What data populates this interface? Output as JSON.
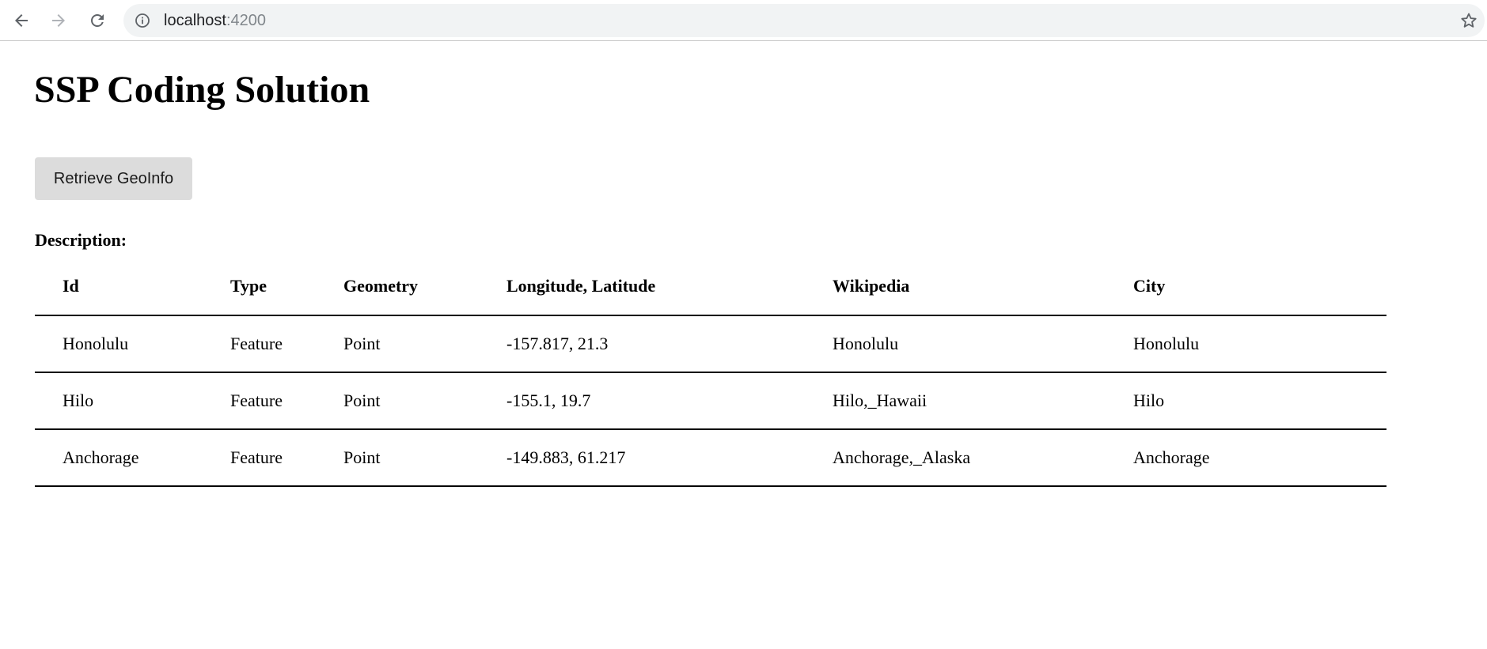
{
  "browser": {
    "url_host": "localhost",
    "url_port": ":4200",
    "icons": {
      "back": "arrow-left-icon",
      "forward": "arrow-right-icon",
      "reload": "reload-icon",
      "site_info": "info-icon",
      "bookmark": "star-icon"
    }
  },
  "page": {
    "title": "SSP Coding Solution",
    "retrieve_button_label": "Retrieve GeoInfo",
    "description_label": "Description:"
  },
  "table": {
    "headers": {
      "id": "Id",
      "type": "Type",
      "geometry": "Geometry",
      "lonlat": "Longitude, Latitude",
      "wikipedia": "Wikipedia",
      "city": "City"
    },
    "rows": [
      {
        "id": "Honolulu",
        "type": "Feature",
        "geometry": "Point",
        "lonlat": "-157.817, 21.3",
        "wikipedia": "Honolulu",
        "city": "Honolulu"
      },
      {
        "id": "Hilo",
        "type": "Feature",
        "geometry": "Point",
        "lonlat": "-155.1, 19.7",
        "wikipedia": "Hilo,_Hawaii",
        "city": "Hilo"
      },
      {
        "id": "Anchorage",
        "type": "Feature",
        "geometry": "Point",
        "lonlat": "-149.883, 61.217",
        "wikipedia": "Anchorage,_Alaska",
        "city": "Anchorage"
      }
    ]
  }
}
